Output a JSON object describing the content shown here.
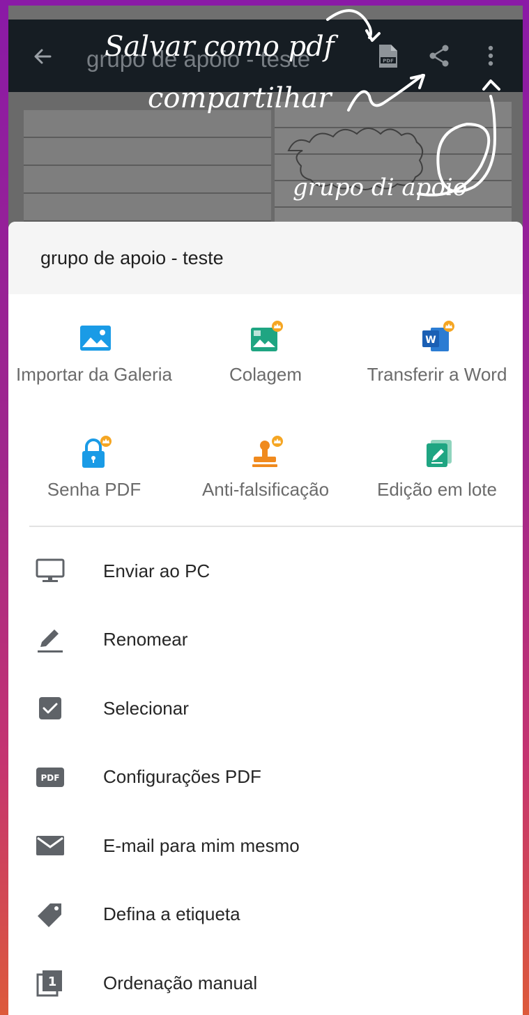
{
  "toolbar": {
    "title": "grupo de apoio - teste",
    "icons": {
      "back": "arrow-left-icon",
      "pdf": "pdf-file-icon",
      "share": "share-icon",
      "more": "more-vertical-icon"
    }
  },
  "annotations": {
    "save_pdf": "Salvar como pdf",
    "share": "compartilhar",
    "photo_text": "grupo di apoio"
  },
  "sheet": {
    "title": "grupo de apoio - teste",
    "tools": [
      {
        "label": "Importar da Galeria",
        "icon": "gallery-icon",
        "premium": false
      },
      {
        "label": "Colagem",
        "icon": "collage-icon",
        "premium": true
      },
      {
        "label": "Transferir a Word",
        "icon": "word-icon",
        "premium": true
      },
      {
        "label": "Senha PDF",
        "icon": "lock-icon",
        "premium": true
      },
      {
        "label": "Anti-falsificação",
        "icon": "stamp-icon",
        "premium": true
      },
      {
        "label": "Edição em lote",
        "icon": "batch-edit-icon",
        "premium": false
      }
    ],
    "menu": [
      {
        "label": "Enviar ao PC",
        "icon": "monitor-icon"
      },
      {
        "label": "Renomear",
        "icon": "pencil-icon"
      },
      {
        "label": "Selecionar",
        "icon": "checkbox-icon"
      },
      {
        "label": "Configurações PDF",
        "icon": "pdf-badge-icon"
      },
      {
        "label": "E-mail para mim mesmo",
        "icon": "mail-icon"
      },
      {
        "label": "Defina a etiqueta",
        "icon": "tag-icon"
      },
      {
        "label": "Ordenação manual",
        "icon": "manual-sort-icon"
      }
    ]
  },
  "colors": {
    "appbar": "#161d23",
    "accent_blue": "#1a9be6",
    "accent_green": "#1fa582",
    "accent_orange": "#f08a1e",
    "premium_badge": "#f5a623",
    "icon_gray": "#5f6368"
  }
}
